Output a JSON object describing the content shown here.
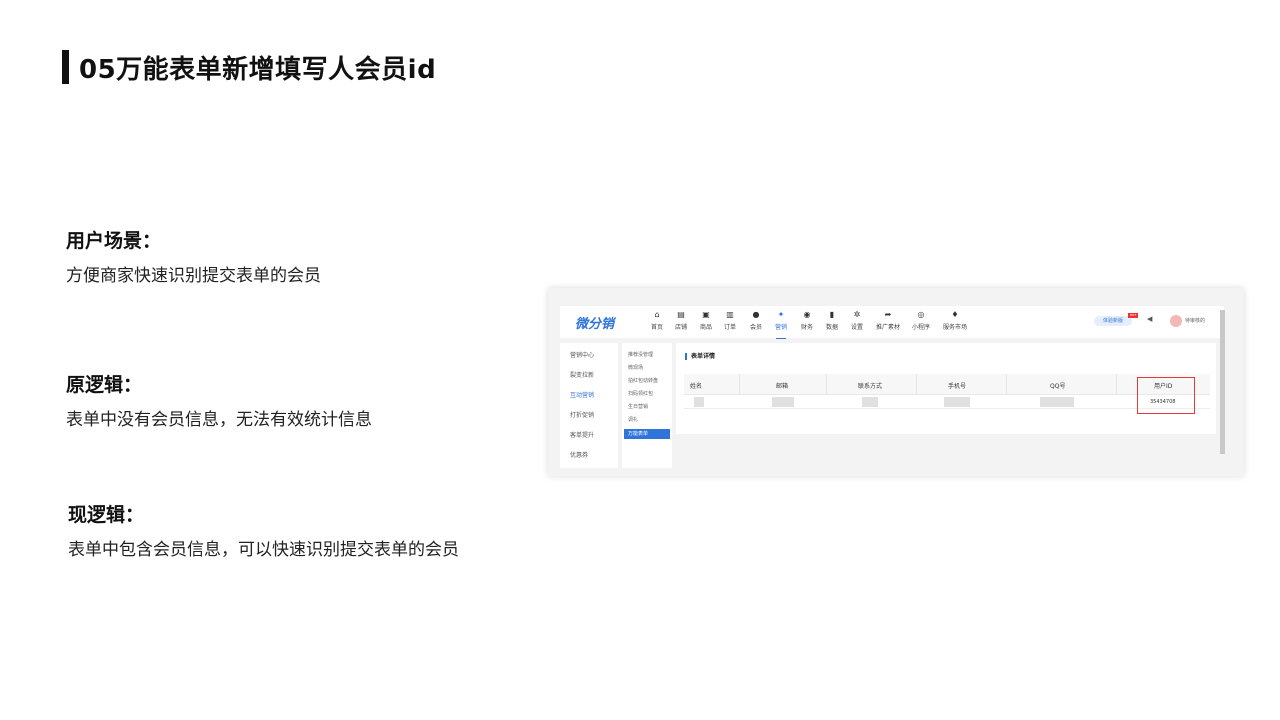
{
  "slide": {
    "title": "05万能表单新增填写人会员id"
  },
  "sections": [
    {
      "heading": "用户场景：",
      "body": "方便商家快速识别提交表单的会员"
    },
    {
      "heading": "原逻辑：",
      "body": "表单中没有会员信息，无法有效统计信息"
    },
    {
      "heading": "现逻辑：",
      "body": "表单中包含会员信息，可以快速识别提交表单的会员"
    }
  ],
  "screenshot": {
    "logo": "微分销",
    "nav": [
      {
        "icon": "home-icon",
        "glyph": "⌂",
        "label": "首页"
      },
      {
        "icon": "store-icon",
        "glyph": "▤",
        "label": "店铺"
      },
      {
        "icon": "goods-icon",
        "glyph": "▣",
        "label": "商品"
      },
      {
        "icon": "order-icon",
        "glyph": "▥",
        "label": "订单"
      },
      {
        "icon": "member-icon",
        "glyph": "●",
        "label": "会员"
      },
      {
        "icon": "marketing-icon",
        "glyph": "✦",
        "label": "营销"
      },
      {
        "icon": "finance-icon",
        "glyph": "◉",
        "label": "财务"
      },
      {
        "icon": "data-icon",
        "glyph": "▮",
        "label": "数据"
      },
      {
        "icon": "settings-icon",
        "glyph": "✲",
        "label": "设置"
      },
      {
        "icon": "promo-icon",
        "glyph": "➦",
        "label": "推广素材"
      },
      {
        "icon": "miniapp-icon",
        "glyph": "◎",
        "label": "小程序"
      },
      {
        "icon": "service-market-icon",
        "glyph": "♦",
        "label": "服务市场"
      }
    ],
    "trial_label": "体验新版",
    "hot_badge": "HOT",
    "user_name": "待审核的",
    "side_primary": [
      {
        "label": "营销中心"
      },
      {
        "label": "裂变拉新"
      },
      {
        "label": "互动营销"
      },
      {
        "label": "打折促销"
      },
      {
        "label": "客单提升"
      },
      {
        "label": "优惠券"
      }
    ],
    "side_secondary": [
      {
        "label": "推荐没管理"
      },
      {
        "label": "微现场"
      },
      {
        "label": "拍红包动转盘"
      },
      {
        "label": "扫码领红包"
      },
      {
        "label": "生日营销"
      },
      {
        "label": "调礼"
      },
      {
        "label": "万能表单"
      }
    ],
    "table": {
      "title": "表单详情",
      "headers": [
        "姓名",
        "邮箱",
        "联系方式",
        "手机号",
        "QQ号",
        "用户ID"
      ],
      "user_id": "35434708"
    }
  }
}
